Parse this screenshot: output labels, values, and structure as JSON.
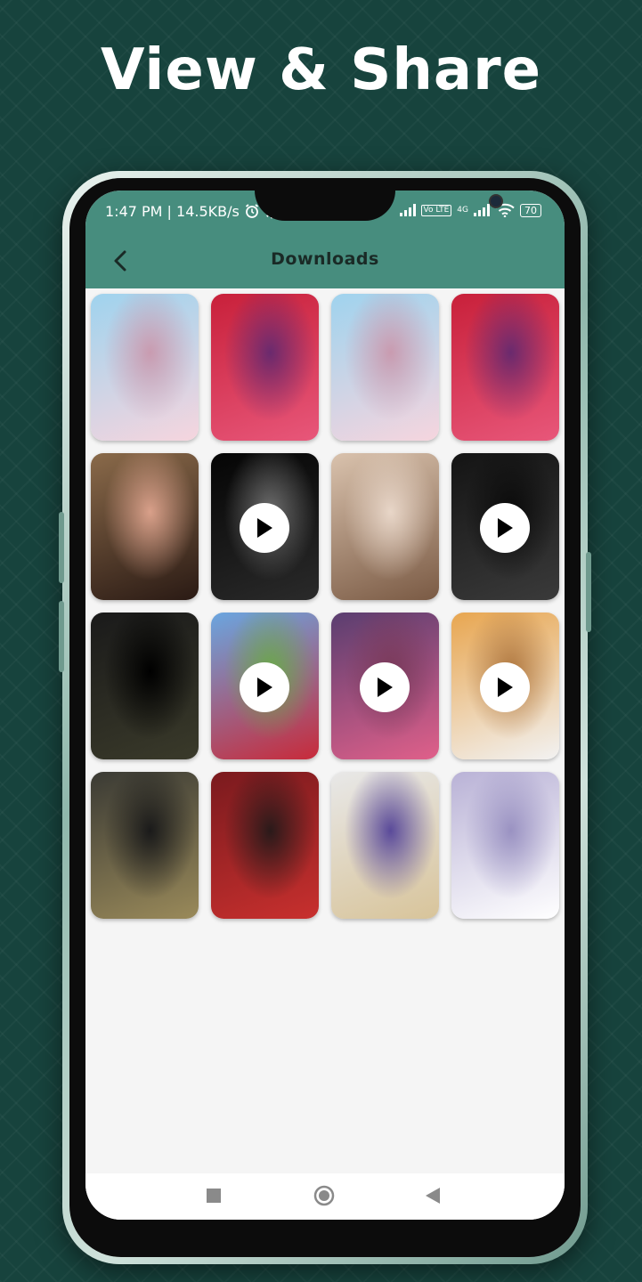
{
  "headline": "View & Share",
  "status_bar": {
    "time": "1:47 PM | 14.5KB/s",
    "volte": "Vo LTE",
    "network": "4G",
    "battery": "70"
  },
  "app_bar": {
    "title": "Downloads"
  },
  "thumbnails": [
    {
      "kind": "image",
      "colors": [
        "#9fd3ee",
        "#f6d5de",
        "#c99bb0"
      ]
    },
    {
      "kind": "image",
      "colors": [
        "#c8203a",
        "#e8577a",
        "#6a2a6e"
      ]
    },
    {
      "kind": "image",
      "colors": [
        "#9fd3ee",
        "#f6d5de",
        "#c99bb0"
      ]
    },
    {
      "kind": "image",
      "colors": [
        "#c8203a",
        "#e8577a",
        "#6a2a6e"
      ]
    },
    {
      "kind": "image",
      "colors": [
        "#8a6a4a",
        "#2a1a14",
        "#d9a08a"
      ]
    },
    {
      "kind": "video",
      "colors": [
        "#050505",
        "#2a2a2a",
        "#6d6d6d"
      ]
    },
    {
      "kind": "image",
      "colors": [
        "#d9c2ad",
        "#7a5a44",
        "#e8d6c8"
      ]
    },
    {
      "kind": "video",
      "colors": [
        "#141414",
        "#3a3a3a",
        "#0a0a0a"
      ]
    },
    {
      "kind": "image",
      "colors": [
        "#1a1a1a",
        "#3a3a2a",
        "#000000"
      ]
    },
    {
      "kind": "video",
      "colors": [
        "#6aa6e0",
        "#c82a3a",
        "#6aa84a"
      ]
    },
    {
      "kind": "video",
      "colors": [
        "#5a3e70",
        "#e0608a",
        "#7a3a5a"
      ]
    },
    {
      "kind": "video",
      "colors": [
        "#e8a650",
        "#f2f2f2",
        "#b07840"
      ]
    },
    {
      "kind": "image",
      "colors": [
        "#3a3a34",
        "#9a8a5a",
        "#1a1a1a"
      ]
    },
    {
      "kind": "image",
      "colors": [
        "#7a1a1e",
        "#c8302e",
        "#2a1a1a"
      ]
    },
    {
      "kind": "image",
      "colors": [
        "#e8e8e8",
        "#d8c49a",
        "#5a4a9a"
      ]
    },
    {
      "kind": "image",
      "colors": [
        "#b9b2d6",
        "#ffffff",
        "#9a92c2"
      ]
    }
  ]
}
